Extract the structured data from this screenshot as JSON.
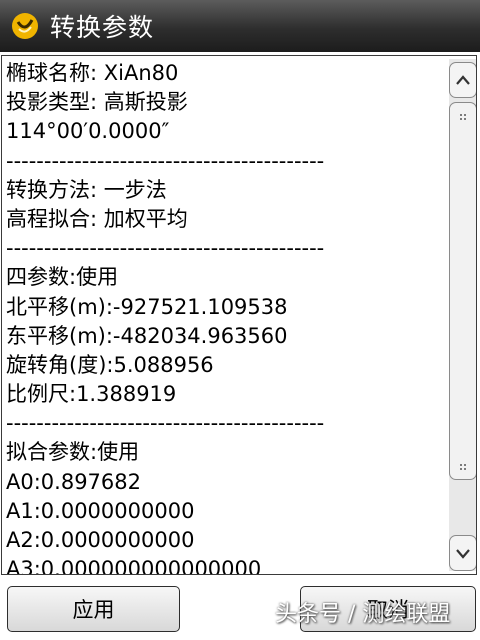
{
  "window": {
    "title": "转换参数",
    "icon": "app-logo-icon",
    "accent": "#f0b400"
  },
  "content": {
    "lines": [
      "椭球名称: XiAn80",
      "投影类型: 高斯投影",
      "114°00′0.0000″",
      "------------------------------------------",
      "转换方法: 一步法",
      "高程拟合: 加权平均",
      "------------------------------------------",
      "四参数:使用",
      "北平移(m):-927521.109538",
      "东平移(m):-482034.963560",
      "旋转角(度):5.088956",
      "比例尺:1.388919",
      "------------------------------------------",
      "拟合参数:使用",
      "A0:0.897682",
      "A1:0.0000000000",
      "A2:0.0000000000",
      "A3:0.000000000000000"
    ]
  },
  "scrollbar": {
    "up_icon": "chevron-up-icon",
    "down_icon": "chevron-down-icon"
  },
  "buttons": {
    "apply_label": "应用",
    "cancel_label": "取消"
  },
  "watermark": {
    "text": "头条号 / 测绘联盟"
  }
}
